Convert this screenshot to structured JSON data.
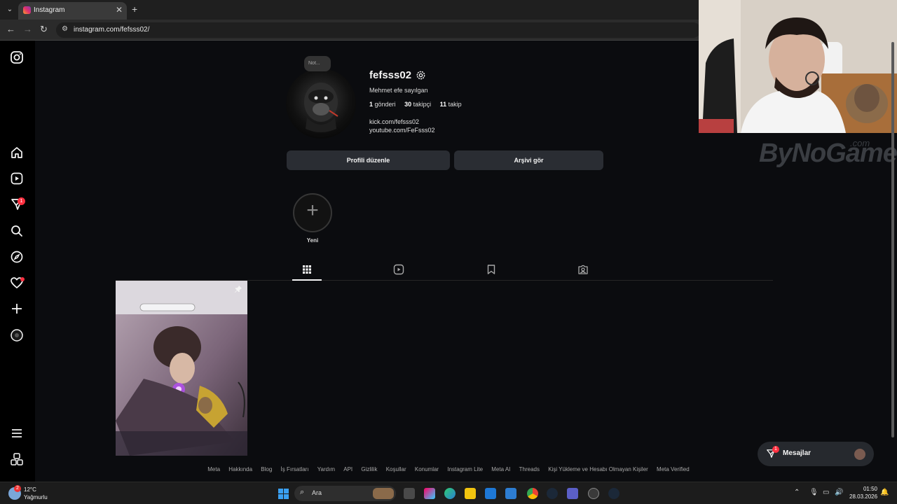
{
  "browser": {
    "tab_title": "Instagram",
    "tab_close": "✕",
    "new_tab": "+",
    "url": "instagram.com/fefsss02/",
    "back": "←",
    "forward": "→",
    "reload": "↻"
  },
  "sidebar": {
    "notifications_badge": "1"
  },
  "profile": {
    "note_placeholder": "Not...",
    "username": "fefsss02",
    "full_name": "Mehmet efe sayılgan",
    "posts_count": "1",
    "posts_label": "gönderi",
    "followers_count": "30",
    "followers_label": "takipçi",
    "following_count": "11",
    "following_label": "takip",
    "links": [
      "kick.com/fefsss02",
      "youtube.com/FeFsss02"
    ],
    "edit_button": "Profili düzenle",
    "archive_button": "Arşivi gör"
  },
  "highlights": {
    "new_label": "Yeni",
    "plus": "+"
  },
  "footer": {
    "links": [
      "Meta",
      "Hakkında",
      "Blog",
      "İş Fırsatları",
      "Yardım",
      "API",
      "Gizlilik",
      "Koşullar",
      "Konumlar",
      "Instagram Lite",
      "Meta AI",
      "Threads",
      "Kişi Yükleme ve Hesabı Olmayan Kişiler",
      "Meta Verified"
    ]
  },
  "messages": {
    "label": "Mesajlar",
    "badge": "1"
  },
  "watermark": {
    "text": "ByNoGame",
    "suffix": ".com"
  },
  "taskbar": {
    "weather_badge": "2",
    "temperature": "12°C",
    "weather_desc": "Yağmurlu",
    "search_label": "Ara",
    "time": "01:50",
    "date": "28.03.2026"
  },
  "colors": {
    "accent_red": "#ff3040",
    "background": "#0b0c0f",
    "button_bg": "#2a2d33"
  }
}
